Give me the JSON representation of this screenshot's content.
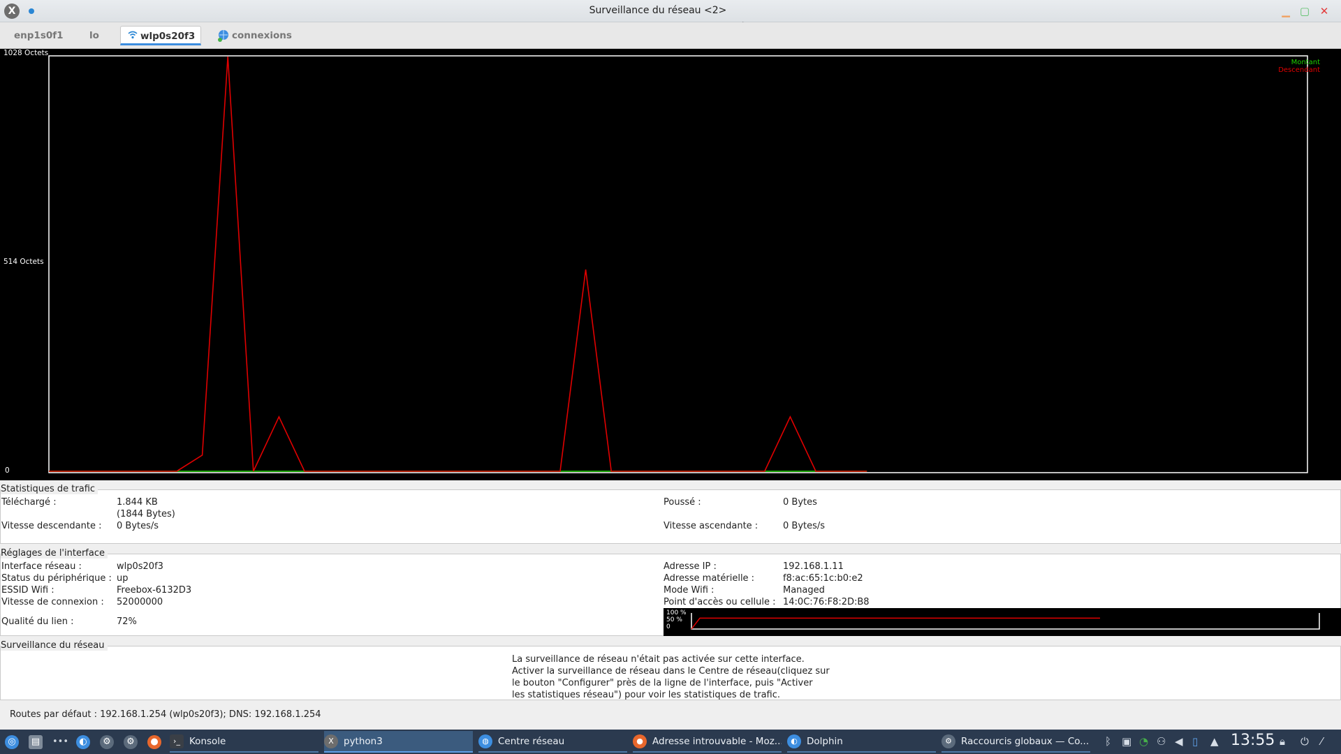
{
  "window": {
    "title": "Surveillance du réseau <2>",
    "icon": "x-app-icon"
  },
  "tabs": [
    {
      "label": "enp1s0f1"
    },
    {
      "label": "lo"
    },
    {
      "label": "wlp0s20f3",
      "icon": "wifi-icon",
      "active": true
    },
    {
      "label": "connexions",
      "icon": "network-connections-icon"
    }
  ],
  "graph": {
    "y_max_label": "1028 Octets",
    "y_mid_label": "514 Octets",
    "y_zero_label": "0",
    "legend_up": "Montant",
    "legend_down": "Descendant",
    "colors": {
      "up": "#1dd100",
      "down": "#e00000",
      "background": "#000000"
    }
  },
  "chart_data": {
    "type": "line",
    "ylim": [
      0,
      1028
    ],
    "ylabel_ticks": [
      "0",
      "514 Octets",
      "1028 Octets"
    ],
    "x": [
      0,
      1,
      2,
      3,
      4,
      5,
      6,
      7,
      8,
      9,
      10,
      11,
      12,
      13,
      14,
      15,
      16,
      17,
      18,
      19,
      20,
      21,
      22,
      23,
      24,
      25,
      26,
      27,
      28,
      29,
      30,
      31,
      32
    ],
    "series": [
      {
        "name": "Descendant",
        "color": "#e00000",
        "values": [
          0,
          0,
          0,
          0,
          0,
          0,
          40,
          1028,
          0,
          135,
          0,
          0,
          0,
          0,
          0,
          0,
          0,
          0,
          0,
          0,
          0,
          500,
          0,
          0,
          0,
          0,
          0,
          0,
          0,
          135,
          0,
          0,
          0
        ]
      },
      {
        "name": "Montant",
        "color": "#1dd100",
        "values": [
          0,
          0,
          0,
          0,
          0,
          0,
          0,
          0,
          0,
          0,
          0,
          0,
          0,
          0,
          0,
          0,
          0,
          0,
          0,
          0,
          0,
          0,
          0,
          0,
          0,
          0,
          0,
          0,
          0,
          0,
          0,
          0,
          0
        ]
      }
    ]
  },
  "traffic": {
    "title": "Statistiques de trafic",
    "downloaded_label": "Téléchargé :",
    "downloaded_value": "1.844 KB",
    "downloaded_bytes": "(1844 Bytes)",
    "down_speed_label": "Vitesse descendante :",
    "down_speed_value": "0 Bytes/s",
    "pushed_label": "Poussé :",
    "pushed_value": "0 Bytes",
    "up_speed_label": "Vitesse ascendante :",
    "up_speed_value": "0 Bytes/s"
  },
  "iface": {
    "title": "Réglages de l'interface",
    "name_label": "Interface réseau :",
    "name_value": "wlp0s20f3",
    "status_label": "Status du périphérique :",
    "status_value": "up",
    "essid_label": "ESSID Wifi :",
    "essid_value": "Freebox-6132D3",
    "speed_label": "Vitesse de connexion :",
    "speed_value": "52000000",
    "quality_label": "Qualité du lien :",
    "quality_value": "72%",
    "ip_label": "Adresse IP :",
    "ip_value": "192.168.1.11",
    "mac_label": "Adresse matérielle :",
    "mac_value": "f8:ac:65:1c:b0:e2",
    "mode_label": "Mode Wifi :",
    "mode_value": "Managed",
    "ap_label": "Point d'accès ou cellule :",
    "ap_value": "14:0C:76:F8:2D:B8",
    "mini_100": "100 %",
    "mini_50": "50 %",
    "mini_0": "0",
    "link_quality_fraction": 0.72
  },
  "monitor": {
    "title": "Surveillance du réseau",
    "line1": "La surveillance de réseau n'était pas activée sur cette interface.",
    "line2": "Activer la surveillance de réseau dans le Centre de réseau(cliquez sur",
    "line3": "le bouton \"Configurer\" près de la ligne de l'interface, puis \"Activer",
    "line4": "les statistiques réseau\") pour voir les statistiques de trafic."
  },
  "status": {
    "routes": "Routes par défaut : 192.168.1.254 (wlp0s20f3); DNS: 192.168.1.254"
  },
  "taskbar": {
    "tasks": [
      {
        "label": "Konsole",
        "icon": "terminal-icon"
      },
      {
        "label": "python3",
        "icon": "x-app-icon",
        "active": true
      },
      {
        "label": "Centre réseau",
        "icon": "network-center-icon"
      },
      {
        "label": "Adresse introuvable - Moz...",
        "icon": "firefox-icon"
      },
      {
        "label": "Dolphin",
        "icon": "dolphin-icon"
      },
      {
        "label": "Raccourcis globaux — Co...",
        "icon": "settings-icon"
      }
    ],
    "clock": "13:55"
  }
}
